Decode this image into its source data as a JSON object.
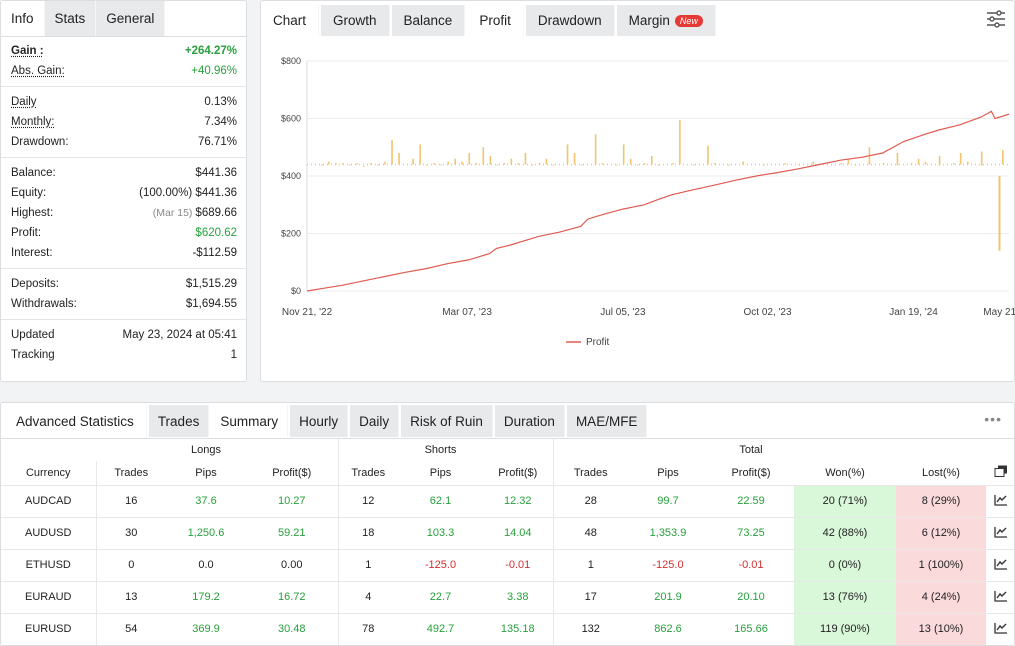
{
  "info_tabs": [
    "Info",
    "Stats",
    "General"
  ],
  "info": {
    "gain_label": "Gain :",
    "gain": "+264.27%",
    "abs_gain_label": "Abs. Gain:",
    "abs_gain": "+40.96%",
    "daily_label": "Daily",
    "daily": "0.13%",
    "monthly_label": "Monthly:",
    "monthly": "7.34%",
    "drawdown_label": "Drawdown:",
    "drawdown": "76.71%",
    "balance_label": "Balance:",
    "balance": "$441.36",
    "equity_label": "Equity:",
    "equity_pct": "(100.00%)",
    "equity": "$441.36",
    "highest_label": "Highest:",
    "highest_date": "(Mar 15)",
    "highest": "$689.66",
    "profit_label": "Profit:",
    "profit": "$620.62",
    "interest_label": "Interest:",
    "interest": "-$112.59",
    "deposits_label": "Deposits:",
    "deposits": "$1,515.29",
    "withdrawals_label": "Withdrawals:",
    "withdrawals": "$1,694.55",
    "updated_label": "Updated",
    "updated": "May 23, 2024 at 05:41",
    "tracking_label": "Tracking",
    "tracking": "1"
  },
  "chart_tabs": [
    "Chart",
    "Growth",
    "Balance",
    "Profit",
    "Drawdown",
    "Margin"
  ],
  "new_badge": "New",
  "chart_data": {
    "type": "line",
    "x_ticks": [
      "Nov 21, '22",
      "Mar 07, '23",
      "Jul 05, '23",
      "Oct 02, '23",
      "Jan 19, '24",
      "May 21, '24"
    ],
    "y_ticks": [
      "$0",
      "$200",
      "$400",
      "$600",
      "$800"
    ],
    "ylim": [
      0,
      800
    ],
    "legend": "Profit",
    "series_color": "#e05a50",
    "bar_color": "#f2c46d",
    "profit_line": [
      [
        0,
        0
      ],
      [
        0.02,
        8
      ],
      [
        0.05,
        20
      ],
      [
        0.08,
        35
      ],
      [
        0.11,
        50
      ],
      [
        0.14,
        65
      ],
      [
        0.17,
        78
      ],
      [
        0.2,
        95
      ],
      [
        0.23,
        108
      ],
      [
        0.26,
        130
      ],
      [
        0.27,
        148
      ],
      [
        0.29,
        160
      ],
      [
        0.31,
        175
      ],
      [
        0.33,
        190
      ],
      [
        0.36,
        205
      ],
      [
        0.39,
        225
      ],
      [
        0.4,
        250
      ],
      [
        0.42,
        265
      ],
      [
        0.45,
        285
      ],
      [
        0.48,
        300
      ],
      [
        0.5,
        318
      ],
      [
        0.52,
        335
      ],
      [
        0.55,
        352
      ],
      [
        0.58,
        368
      ],
      [
        0.61,
        385
      ],
      [
        0.64,
        400
      ],
      [
        0.67,
        412
      ],
      [
        0.7,
        425
      ],
      [
        0.73,
        440
      ],
      [
        0.76,
        455
      ],
      [
        0.79,
        465
      ],
      [
        0.82,
        480
      ],
      [
        0.85,
        520
      ],
      [
        0.88,
        545
      ],
      [
        0.9,
        560
      ],
      [
        0.93,
        578
      ],
      [
        0.96,
        605
      ],
      [
        0.975,
        625
      ],
      [
        0.98,
        600
      ],
      [
        1.0,
        615
      ]
    ],
    "bars": [
      [
        0.02,
        440
      ],
      [
        0.03,
        450
      ],
      [
        0.04,
        445
      ],
      [
        0.05,
        445
      ],
      [
        0.06,
        440
      ],
      [
        0.07,
        445
      ],
      [
        0.08,
        435
      ],
      [
        0.09,
        445
      ],
      [
        0.1,
        440
      ],
      [
        0.11,
        450
      ],
      [
        0.13,
        480
      ],
      [
        0.15,
        460
      ],
      [
        0.17,
        440
      ],
      [
        0.18,
        445
      ],
      [
        0.19,
        440
      ],
      [
        0.2,
        450
      ],
      [
        0.21,
        460
      ],
      [
        0.22,
        450
      ],
      [
        0.23,
        480
      ],
      [
        0.24,
        445
      ],
      [
        0.26,
        470
      ],
      [
        0.27,
        440
      ],
      [
        0.28,
        445
      ],
      [
        0.29,
        460
      ],
      [
        0.3,
        445
      ],
      [
        0.31,
        480
      ],
      [
        0.32,
        440
      ],
      [
        0.33,
        445
      ],
      [
        0.34,
        460
      ],
      [
        0.35,
        440
      ],
      [
        0.38,
        480
      ],
      [
        0.39,
        440
      ],
      [
        0.42,
        445
      ],
      [
        0.44,
        440
      ],
      [
        0.46,
        460
      ],
      [
        0.47,
        440
      ],
      [
        0.48,
        445
      ],
      [
        0.49,
        470
      ],
      [
        0.5,
        440
      ],
      [
        0.52,
        445
      ],
      [
        0.55,
        440
      ],
      [
        0.58,
        445
      ],
      [
        0.6,
        440
      ],
      [
        0.62,
        450
      ],
      [
        0.65,
        440
      ],
      [
        0.68,
        445
      ],
      [
        0.7,
        440
      ],
      [
        0.72,
        450
      ],
      [
        0.74,
        440
      ],
      [
        0.76,
        445
      ],
      [
        0.78,
        440
      ],
      [
        0.8,
        450
      ],
      [
        0.82,
        445
      ],
      [
        0.84,
        440
      ],
      [
        0.86,
        445
      ],
      [
        0.88,
        450
      ],
      [
        0.9,
        440
      ],
      [
        0.92,
        445
      ],
      [
        0.94,
        450
      ],
      [
        0.96,
        440
      ]
    ],
    "bars_tall": [
      [
        0.12,
        525
      ],
      [
        0.16,
        510
      ],
      [
        0.25,
        500
      ],
      [
        0.37,
        510
      ],
      [
        0.41,
        545
      ],
      [
        0.45,
        510
      ],
      [
        0.53,
        595
      ],
      [
        0.57,
        505
      ],
      [
        0.77,
        460
      ],
      [
        0.8,
        500
      ],
      [
        0.84,
        480
      ],
      [
        0.87,
        460
      ],
      [
        0.9,
        470
      ],
      [
        0.93,
        480
      ],
      [
        0.96,
        485
      ],
      [
        0.99,
        490
      ]
    ],
    "neg_bar": [
      0.985,
      140
    ]
  },
  "adv_tabs": [
    "Advanced Statistics",
    "Trades",
    "Summary",
    "Hourly",
    "Daily",
    "Risk of Ruin",
    "Duration",
    "MAE/MFE"
  ],
  "table": {
    "group_headers": [
      "Longs",
      "Shorts",
      "Total"
    ],
    "headers": [
      "Currency",
      "Trades",
      "Pips",
      "Profit($)",
      "Trades",
      "Pips",
      "Profit($)",
      "Trades",
      "Pips",
      "Profit($)",
      "Won(%)",
      "Lost(%)"
    ],
    "rows": [
      [
        "AUDCAD",
        "16",
        "37.6",
        "10.27",
        "12",
        "62.1",
        "12.32",
        "28",
        "99.7",
        "22.59",
        "20 (71%)",
        "8 (29%)"
      ],
      [
        "AUDUSD",
        "30",
        "1,250.6",
        "59.21",
        "18",
        "103.3",
        "14.04",
        "48",
        "1,353.9",
        "73.25",
        "42 (88%)",
        "6 (12%)"
      ],
      [
        "ETHUSD",
        "0",
        "0.0",
        "0.00",
        "1",
        "-125.0",
        "-0.01",
        "1",
        "-125.0",
        "-0.01",
        "0 (0%)",
        "1 (100%)"
      ],
      [
        "EURAUD",
        "13",
        "179.2",
        "16.72",
        "4",
        "22.7",
        "3.38",
        "17",
        "201.9",
        "20.10",
        "13 (76%)",
        "4 (24%)"
      ],
      [
        "EURUSD",
        "54",
        "369.9",
        "30.48",
        "78",
        "492.7",
        "135.18",
        "132",
        "862.6",
        "165.66",
        "119 (90%)",
        "13 (10%)"
      ]
    ]
  }
}
